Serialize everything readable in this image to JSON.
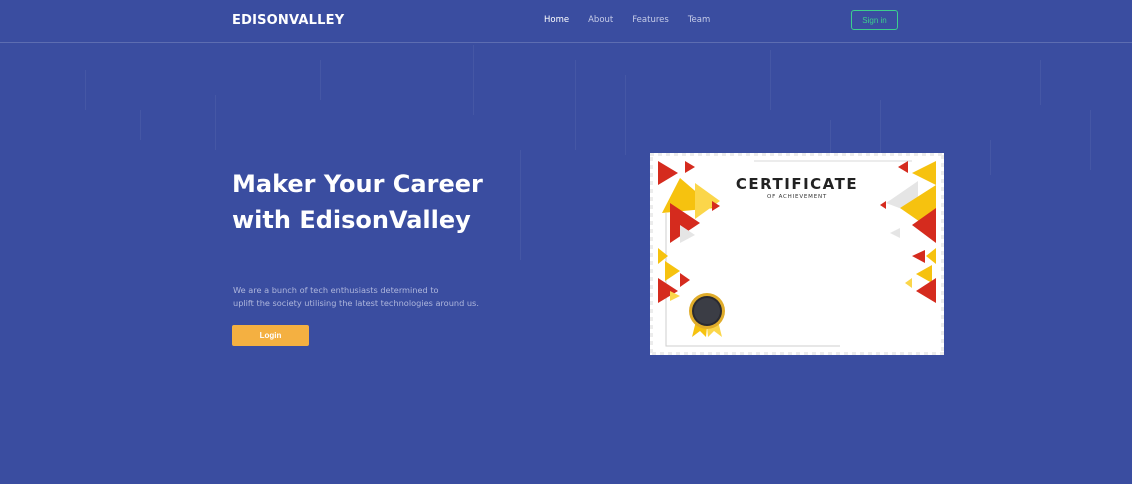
{
  "brand": "EDISONVALLEY",
  "nav": {
    "items": [
      {
        "label": "Home",
        "active": true
      },
      {
        "label": "About",
        "active": false
      },
      {
        "label": "Features",
        "active": false
      },
      {
        "label": "Team",
        "active": false
      }
    ],
    "signin_label": "Sign in"
  },
  "hero": {
    "title_line1": "Maker Your Career",
    "title_line2": "with EdisonValley",
    "desc_line1": "We are a bunch of tech enthusiasts determined to",
    "desc_line2": "uplift the society utilising the latest technologies around us.",
    "login_label": "Login"
  },
  "certificate": {
    "title": "CERTIFICATE",
    "subtitle": "OF ACHIEVEMENT"
  },
  "colors": {
    "background": "#3a4da0",
    "signin_accent": "#3ccf8e",
    "login_button": "#f4b041",
    "cert_red": "#d52b1e",
    "cert_yellow": "#f6c20f"
  }
}
